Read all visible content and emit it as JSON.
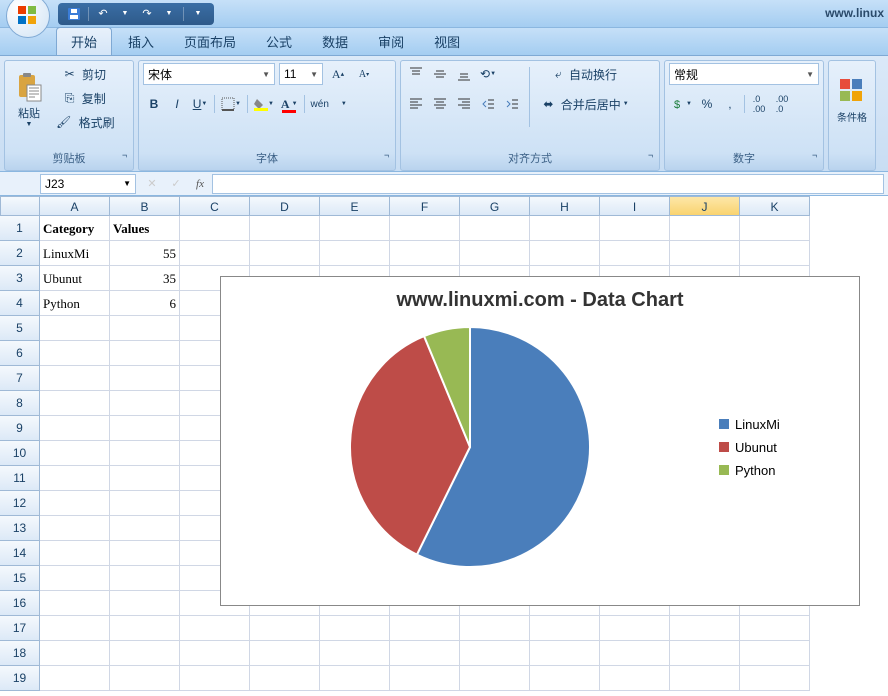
{
  "title_url": "www.linux",
  "tabs": [
    "开始",
    "插入",
    "页面布局",
    "公式",
    "数据",
    "审阅",
    "视图"
  ],
  "active_tab": 0,
  "ribbon": {
    "clipboard": {
      "paste": "粘贴",
      "cut": "剪切",
      "copy": "复制",
      "format_painter": "格式刷",
      "label": "剪贴板"
    },
    "font": {
      "name": "宋体",
      "size": "11",
      "label": "字体"
    },
    "alignment": {
      "wrap": "自动换行",
      "merge": "合并后居中",
      "label": "对齐方式"
    },
    "number": {
      "format": "常规",
      "label": "数字"
    },
    "styles": {
      "conditional": "条件格"
    }
  },
  "name_box": "J23",
  "columns": [
    "A",
    "B",
    "C",
    "D",
    "E",
    "F",
    "G",
    "H",
    "I",
    "J",
    "K"
  ],
  "selected_col": "J",
  "row_count": 19,
  "cells": {
    "A1": "Category",
    "B1": "Values",
    "A2": "LinuxMi",
    "B2": "55",
    "A3": "Ubunut",
    "B3": "35",
    "A4": "Python",
    "B4": "6"
  },
  "chart_data": {
    "type": "pie",
    "title": "www.linuxmi.com - Data Chart",
    "categories": [
      "LinuxMi",
      "Ubunut",
      "Python"
    ],
    "values": [
      55,
      35,
      6
    ],
    "colors": [
      "#4a7ebb",
      "#be4c48",
      "#98b954"
    ]
  }
}
